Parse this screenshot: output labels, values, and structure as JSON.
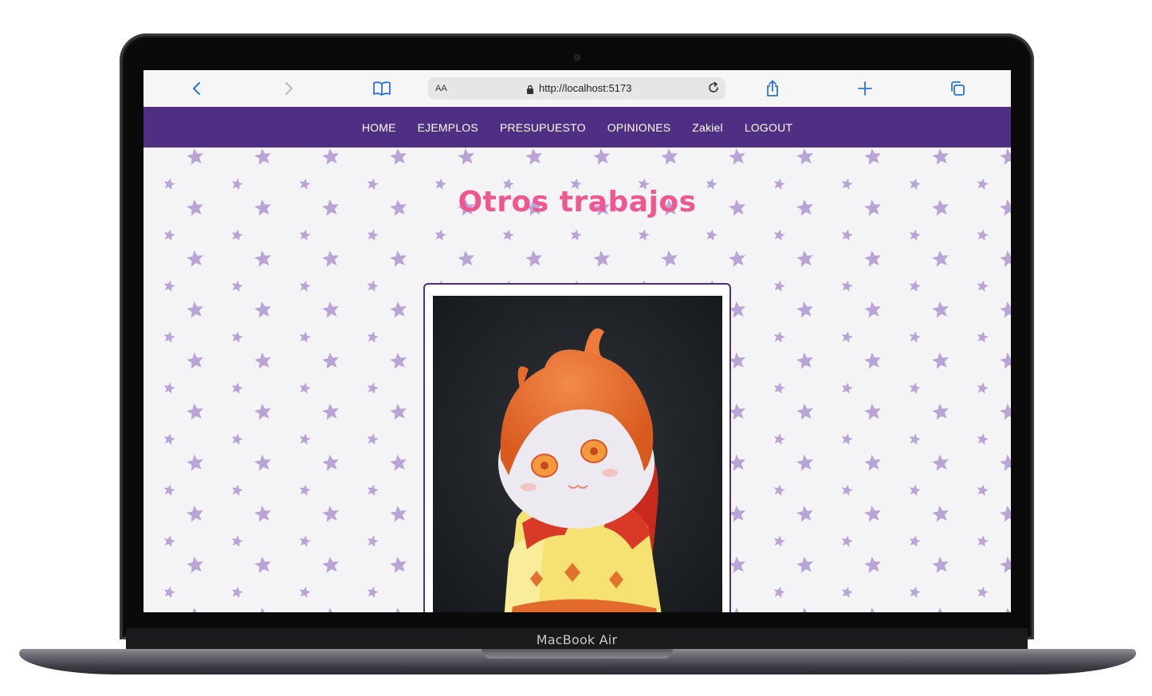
{
  "device": {
    "label": "MacBook Air"
  },
  "browser": {
    "url": "http://localhost:5173",
    "text_size_label": "AA",
    "icons": [
      "back-icon",
      "forward-icon",
      "bookmarks-icon",
      "lock-icon",
      "reload-icon",
      "share-icon",
      "new-tab-icon",
      "tabs-icon"
    ]
  },
  "nav": {
    "items": [
      "HOME",
      "EJEMPLOS",
      "PRESUPUESTO",
      "OPINIONES",
      "Zakiel",
      "LOGOUT"
    ],
    "background": "#4e2f84"
  },
  "page": {
    "title": "Otros trabajos",
    "title_color": "#f0568f",
    "star_color": "#b9a4d6"
  }
}
